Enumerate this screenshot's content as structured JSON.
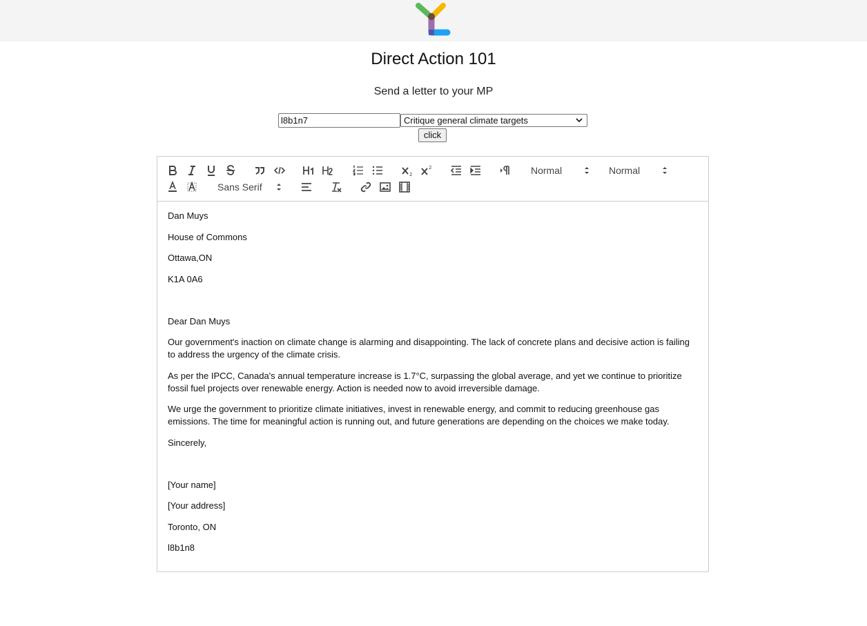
{
  "page": {
    "title": "Direct Action 101",
    "subtitle": "Send a letter to your MP"
  },
  "form": {
    "postal_code_value": "l8b1n7",
    "topic_selected": "Critique general climate targets",
    "submit_label": "click"
  },
  "toolbar": {
    "header_select": "Normal",
    "size_select": "Normal",
    "font_select": "Sans Serif"
  },
  "letter": {
    "lines": [
      "Dan Muys",
      "House of Commons",
      "Ottawa,ON",
      "K1A 0A6",
      "",
      "Dear Dan Muys",
      "Our government's inaction on climate change is alarming and disappointing. The lack of concrete plans and decisive action is failing to address the urgency of the climate crisis.",
      "As per the IPCC, Canada's annual temperature increase is 1.7°C, surpassing the global average, and yet we continue to prioritize fossil fuel projects over renewable energy. Action is needed now to avoid irreversible damage.",
      "We urge the government to prioritize climate initiatives, invest in renewable energy, and commit to reducing greenhouse gas emissions. The time for meaningful action is running out, and future generations are depending on the choices we make today.",
      "Sincerely,",
      "",
      "[Your name]",
      "[Your address]",
      "Toronto, ON",
      "l8b1n8"
    ]
  },
  "colors": {
    "header_bg": "#f4f4f4",
    "logo_green": "#5cb85c",
    "logo_yellow": "#f5b800",
    "logo_purple": "#9b6fb0",
    "logo_blue": "#1da1f2"
  }
}
